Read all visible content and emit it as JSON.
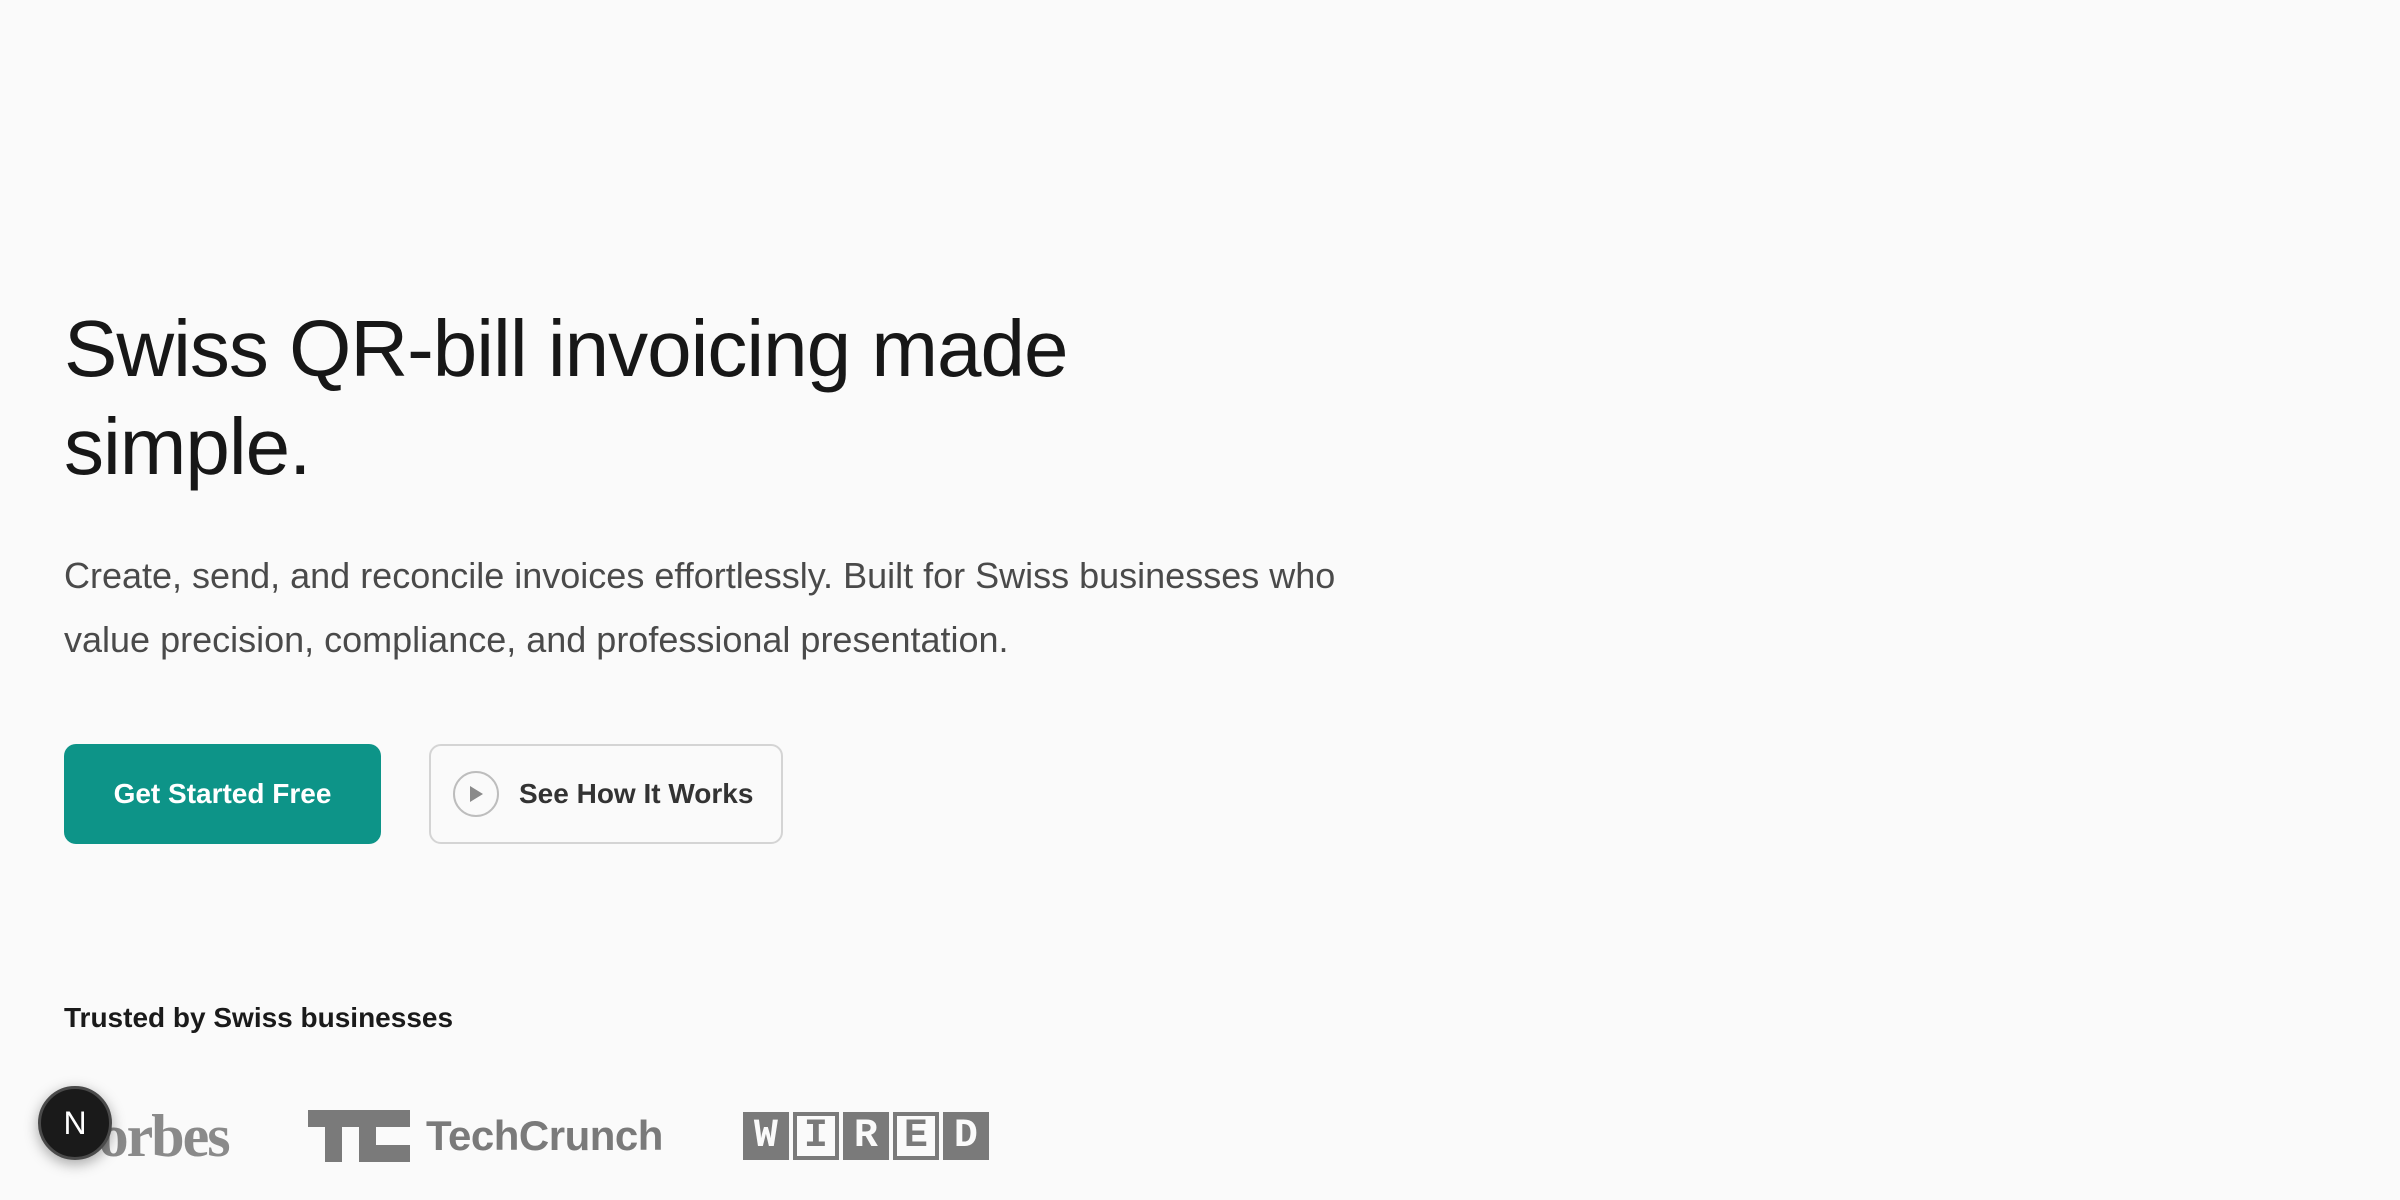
{
  "hero": {
    "headline": "Swiss QR-bill invoicing made simple.",
    "subheadline": "Create, send, and reconcile invoices effortlessly. Built for Swiss businesses who value precision, compliance, and professional presentation.",
    "primary_cta": "Get Started Free",
    "secondary_cta": "See How It Works"
  },
  "trusted": {
    "title": "Trusted by Swiss businesses",
    "logos": {
      "forbes": "Forbes",
      "techcrunch": "TechCrunch",
      "wired": [
        "W",
        "I",
        "R",
        "E",
        "D"
      ]
    }
  },
  "dev_badge": {
    "letter": "N"
  },
  "colors": {
    "background": "#fafafa",
    "accent": "#0d9488",
    "text_primary": "#171717",
    "text_secondary": "#4a4a4a",
    "logo_gray": "#7a7a7a"
  },
  "icons": {
    "play": "play-icon"
  }
}
